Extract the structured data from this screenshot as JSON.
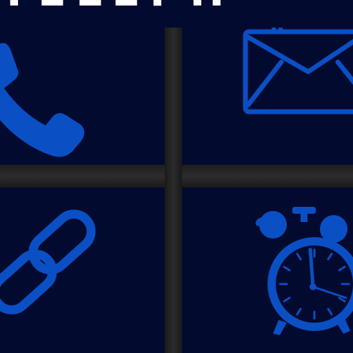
{
  "header": {
    "text": "TELEPH"
  },
  "tiles": [
    {
      "label": "",
      "icon": "phone-icon"
    },
    {
      "label": "",
      "icon": "mail-icon"
    },
    {
      "label": "",
      "icon": "link-icon"
    },
    {
      "label": "",
      "icon": "alarm-clock-icon"
    }
  ],
  "colors": {
    "background": "#030a2f",
    "icon": "#0a4fc4",
    "divider": "#222222",
    "text": "#ffffff"
  }
}
